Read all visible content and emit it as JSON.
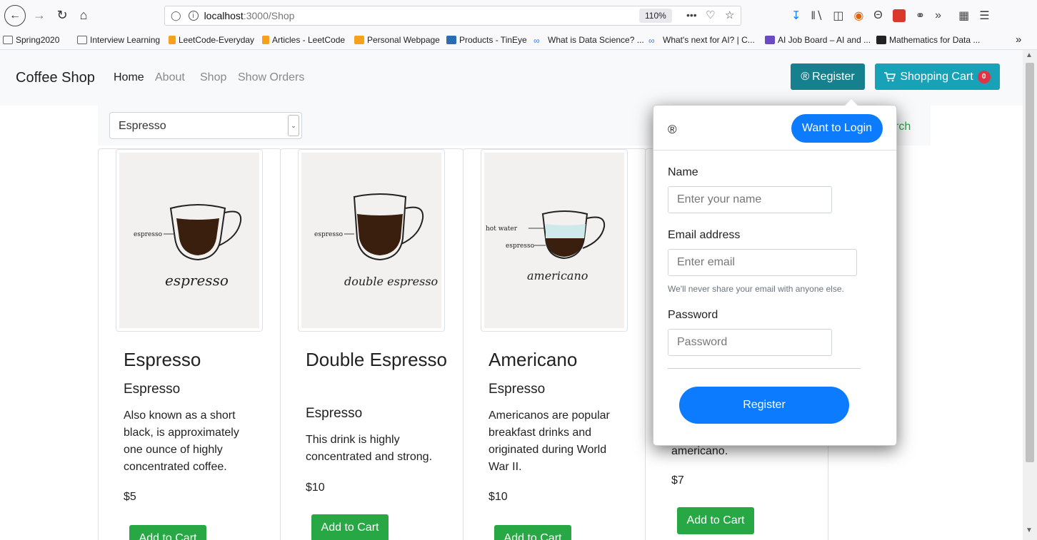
{
  "browser": {
    "url_host": "localhost",
    "url_path": ":3000/Shop",
    "zoom": "110%",
    "more_label": "•••",
    "bookmarks": [
      {
        "label": "Spring2020",
        "color": "#e8e8e8"
      },
      {
        "label": "Interview Learning",
        "color": "#e8e8e8"
      },
      {
        "label": "LeetCode-Everyday",
        "color": "#f89f1b"
      },
      {
        "label": "Articles - LeetCode",
        "color": "#f89f1b"
      },
      {
        "label": "Personal Webpage",
        "color": "#f4a21b"
      },
      {
        "label": "Products - TinEye",
        "color": "#2a6db3"
      },
      {
        "label": "What is Data Science? ...",
        "color": "#3b7de0"
      },
      {
        "label": "What's next for AI? | C...",
        "color": "#3b7de0"
      },
      {
        "label": "AI Job Board – AI and ...",
        "color": "#6a4bc4"
      },
      {
        "label": "Mathematics for Data ...",
        "color": "#222222"
      }
    ]
  },
  "navbar": {
    "brand": "Coffee Shop",
    "links": [
      "Home",
      "About",
      "Shop",
      "Show Orders"
    ],
    "register_label": "Register",
    "register_mark": "®",
    "cart_label": "Shopping Cart",
    "cart_count": "0"
  },
  "filter": {
    "selected": "Espresso",
    "search_tail": "rch"
  },
  "products": [
    {
      "name": "Espresso",
      "category": "Espresso",
      "description": "Also known as a short black, is approximately one ounce of highly concentrated coffee.",
      "price": "$5",
      "add_label": "Add to Cart",
      "img_labels": [
        "espresso"
      ],
      "img_caption": "espresso"
    },
    {
      "name": "Double Espresso",
      "category": "Espresso",
      "description": "This drink is highly concentrated and strong.",
      "price": "$10",
      "add_label": "Add to Cart",
      "img_labels": [
        "espresso"
      ],
      "img_caption": "double espresso"
    },
    {
      "name": "Americano",
      "category": "Espresso",
      "description": "Americanos are popular breakfast drinks and originated during World War II.",
      "price": "$10",
      "add_label": "Add to Cart",
      "img_labels": [
        "hot water",
        "espresso"
      ],
      "img_caption": "americano"
    },
    {
      "description_tail": "americano.",
      "price": "$7",
      "add_label": "Add to Cart"
    }
  ],
  "popover": {
    "mark": "®",
    "want_login": "Want to Login",
    "name_label": "Name",
    "name_placeholder": "Enter your name",
    "email_label": "Email address",
    "email_placeholder": "Enter email",
    "email_help": "We'll never share your email with anyone else.",
    "password_label": "Password",
    "password_placeholder": "Password",
    "submit": "Register"
  },
  "colors": {
    "register_nav": "#17808f",
    "cart": "#17a2b8",
    "primary": "#0d7bfd",
    "success": "#28a745",
    "badge": "#dc3545"
  }
}
